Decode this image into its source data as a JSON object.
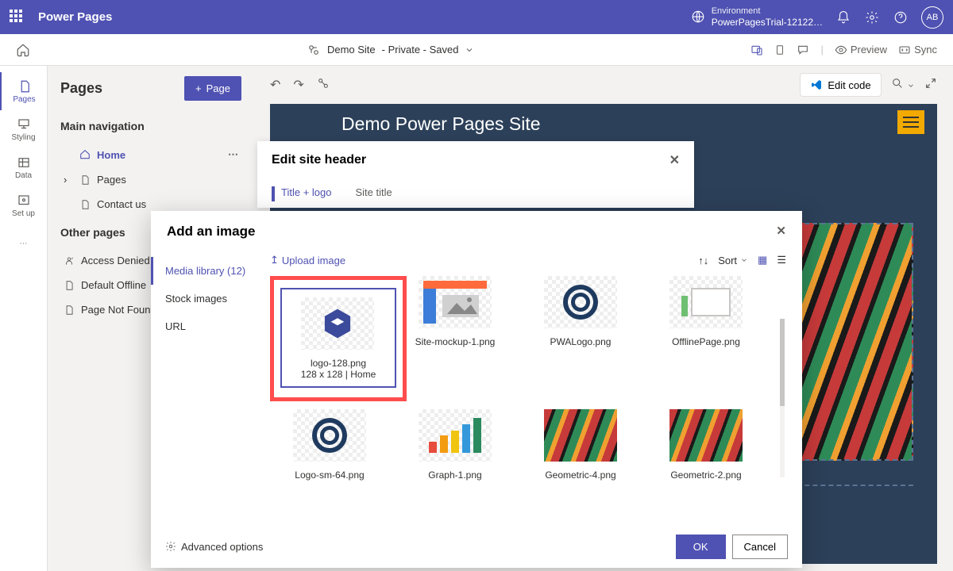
{
  "brand": "Power Pages",
  "environment": {
    "label": "Environment",
    "value": "PowerPagesTrial-12122…"
  },
  "avatar_initials": "AB",
  "subheader": {
    "site_name": "Demo Site",
    "site_meta": "Private - Saved",
    "preview": "Preview",
    "sync": "Sync"
  },
  "leftrail": {
    "pages": "Pages",
    "styling": "Styling",
    "data": "Data",
    "setup": "Set up"
  },
  "pages_panel": {
    "title": "Pages",
    "add_label": "Page",
    "nav_heading": "Main navigation",
    "items": {
      "home": "Home",
      "pages": "Pages",
      "contact": "Contact us"
    },
    "other_heading": "Other pages",
    "other_items": {
      "access": "Access Denied",
      "offline": "Default Offline",
      "notfound": "Page Not Found"
    }
  },
  "canvas": {
    "edit_code": "Edit code",
    "site_title": "Demo Power Pages Site"
  },
  "edit_header": {
    "title": "Edit site header",
    "tabs": {
      "title_logo": "Title + logo",
      "site_title": "Site title"
    }
  },
  "modal": {
    "title": "Add an image",
    "side": {
      "media": "Media library (12)",
      "stock": "Stock images",
      "url": "URL"
    },
    "upload": "Upload image",
    "sort": "Sort",
    "thumbs": [
      {
        "name": "logo-128.png",
        "meta": "128 x 128 | Home",
        "selected": true,
        "kind": "cube"
      },
      {
        "name": "Site-mockup-1.png",
        "kind": "mockup"
      },
      {
        "name": "PWALogo.png",
        "kind": "spiral"
      },
      {
        "name": "OfflinePage.png",
        "kind": "offline"
      },
      {
        "name": "Logo-sm-64.png",
        "kind": "spiral"
      },
      {
        "name": "Graph-1.png",
        "kind": "barchart"
      },
      {
        "name": "Geometric-4.png",
        "kind": "geo"
      },
      {
        "name": "Geometric-2.png",
        "kind": "geo"
      }
    ],
    "advanced": "Advanced options",
    "ok": "OK",
    "cancel": "Cancel"
  }
}
